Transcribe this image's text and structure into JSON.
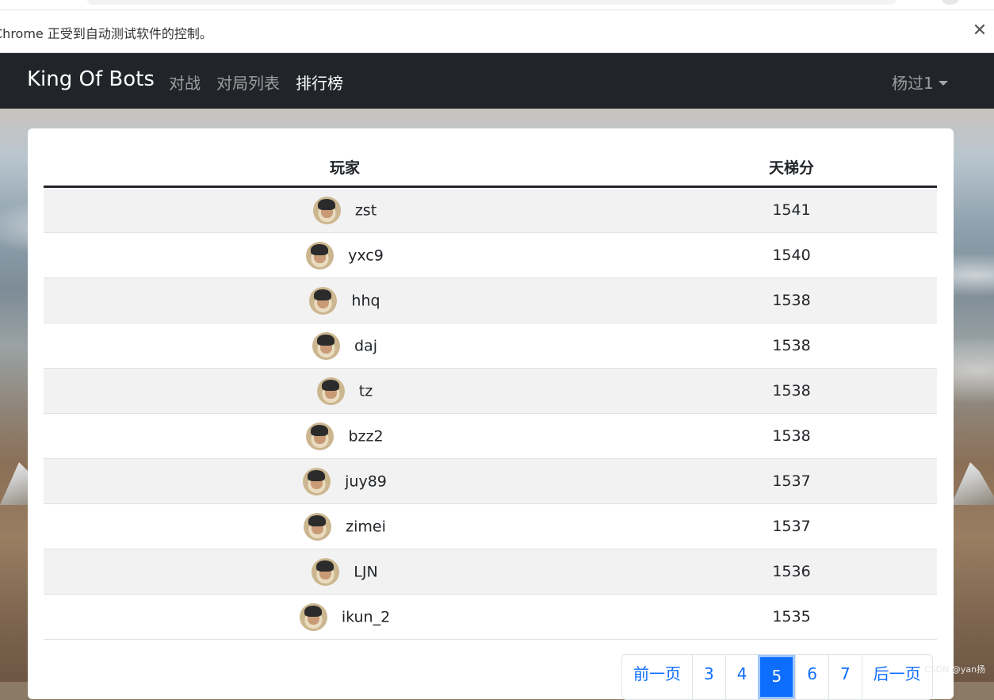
{
  "browser": {
    "infobar_message": "Chrome 正受到自动测试软件的控制。",
    "close_glyph": "✕"
  },
  "navbar": {
    "brand": "King Of Bots",
    "links": [
      "对战",
      "对局列表",
      "排行榜"
    ],
    "active_link": "排行榜",
    "user": "杨过1"
  },
  "ranklist": {
    "headers": {
      "player": "玩家",
      "rating": "天梯分"
    },
    "rows": [
      {
        "name": "zst",
        "rating": "1541"
      },
      {
        "name": "yxc9",
        "rating": "1540"
      },
      {
        "name": "hhq",
        "rating": "1538"
      },
      {
        "name": "daj",
        "rating": "1538"
      },
      {
        "name": "tz",
        "rating": "1538"
      },
      {
        "name": "bzz2",
        "rating": "1538"
      },
      {
        "name": "juy89",
        "rating": "1537"
      },
      {
        "name": "zimei",
        "rating": "1537"
      },
      {
        "name": "LJN",
        "rating": "1536"
      },
      {
        "name": "ikun_2",
        "rating": "1535"
      }
    ]
  },
  "pagination": {
    "prev": "前一页",
    "pages": [
      "3",
      "4",
      "5",
      "6",
      "7"
    ],
    "current": "5",
    "next": "后一页"
  },
  "watermark": "CSDN @yan扬",
  "colors": {
    "navbar": "#212529",
    "accent": "#0d6efd",
    "striped_row": "#f2f2f2"
  }
}
